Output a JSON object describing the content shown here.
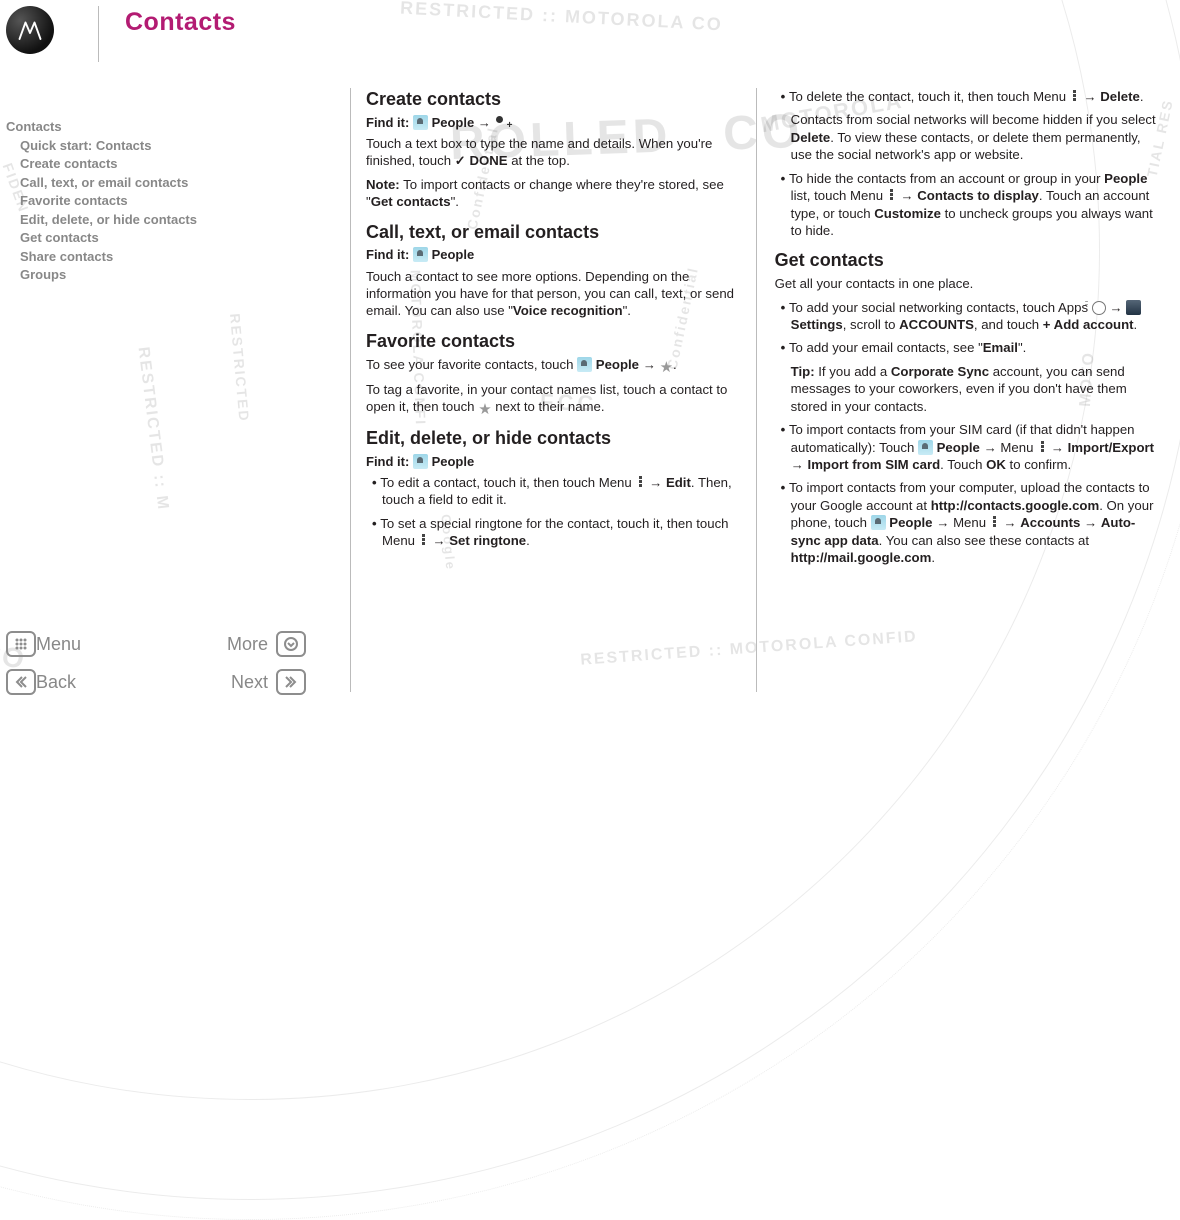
{
  "page_title": "Contacts",
  "sidebar": {
    "heading": "Contacts",
    "items": [
      "Quick start: Contacts",
      "Create contacts",
      "Call, text, or email contacts",
      "Favorite contacts",
      "Edit, delete, or hide contacts",
      "Get contacts",
      "Share contacts",
      "Groups"
    ]
  },
  "nav": {
    "menu": "Menu",
    "more": "More",
    "back": "Back",
    "next": "Next"
  },
  "col1": {
    "h_create": "Create contacts",
    "findit_label": "Find it:",
    "people_label": "People",
    "arrow": "→",
    "create_p1a": "Touch a text box to type the name and details. When you're finished, touch ",
    "done_label": "DONE",
    "create_p1b": " at the top.",
    "note_label": "Note:",
    "note_text_a": " To import contacts or change where they're stored, see \"",
    "note_link": "Get contacts",
    "note_text_b": "\".",
    "h_call": "Call, text, or email contacts",
    "call_p1a": "Touch a contact to see more options. Depending on the information you have for that person, you can call, text, or send email. You can also use \"",
    "voice_link": "Voice recognition",
    "call_p1b": "\".",
    "h_fav": "Favorite contacts",
    "fav_p1a": "To see your favorite contacts, touch ",
    "fav_p1b": ".",
    "fav_p2a": "To tag a favorite, in your contact names list, touch a contact to open it, then touch ",
    "fav_p2b": " next to their name.",
    "h_edit": "Edit, delete, or hide contacts",
    "edit_b1a": "To edit a contact, touch it, then touch Menu ",
    "edit_b1_action": "Edit",
    "edit_b1b": ". Then, touch a field to edit it.",
    "edit_b2a": "To set a special ringtone for the contact, touch it, then touch Menu ",
    "edit_b2_action": "Set ringtone",
    "edit_b2b": "."
  },
  "col2": {
    "del_b1a": "To delete the contact, touch it, then touch Menu ",
    "arrow": "→",
    "del_action": "Delete",
    "del_b1b": ".",
    "del_p_a": "Contacts from social networks will become hidden if you select ",
    "del_p_b": ". To view these contacts, or delete them permanently, use the social network's app or website.",
    "hide_a": "To hide the contacts from an account or group in your ",
    "people_label": "People",
    "hide_b": " list, touch Menu ",
    "hide_action": "Contacts to display",
    "hide_c": ". Touch an account type, or touch ",
    "customize": "Customize",
    "hide_d": " to uncheck groups you always want to hide.",
    "h_get": "Get contacts",
    "get_intro": "Get all your contacts in one place.",
    "get_b1a": "To add your social networking contacts, touch Apps ",
    "settings_label": "Settings",
    "get_b1b": ", scroll to ",
    "accounts_label": "ACCOUNTS",
    "get_b1c": ", and touch ",
    "add_account": "+ Add account",
    "get_b1d": ".",
    "get_b2a": "To add your email contacts, see \"",
    "email_link": "Email",
    "get_b2b": "\".",
    "tip_label": "Tip:",
    "tip_a": " If you add a ",
    "corp_sync": "Corporate Sync",
    "tip_b": " account, you can send messages to your coworkers, even if you don't have them stored in your contacts.",
    "get_b3a": "To import contacts from your SIM card (if that didn't happen automatically): Touch ",
    "get_b3b": "Menu ",
    "import_export": "Import/Export",
    "import_sim": "Import from SIM card",
    "get_b3c": ". Touch ",
    "ok_label": "OK",
    "get_b3d": " to confirm.",
    "get_b4a": "To import contacts from your computer, upload the contacts to your Google account at ",
    "url1": "http://contacts.google.com",
    "get_b4b": ". On your phone, touch ",
    "get_b4c": "Menu ",
    "accounts_menu": "Accounts",
    "autosync": "Auto-sync app data",
    "get_b4d": ". You can also see these contacts at ",
    "url2": "http://mail.google.com",
    "get_b4e": "."
  }
}
